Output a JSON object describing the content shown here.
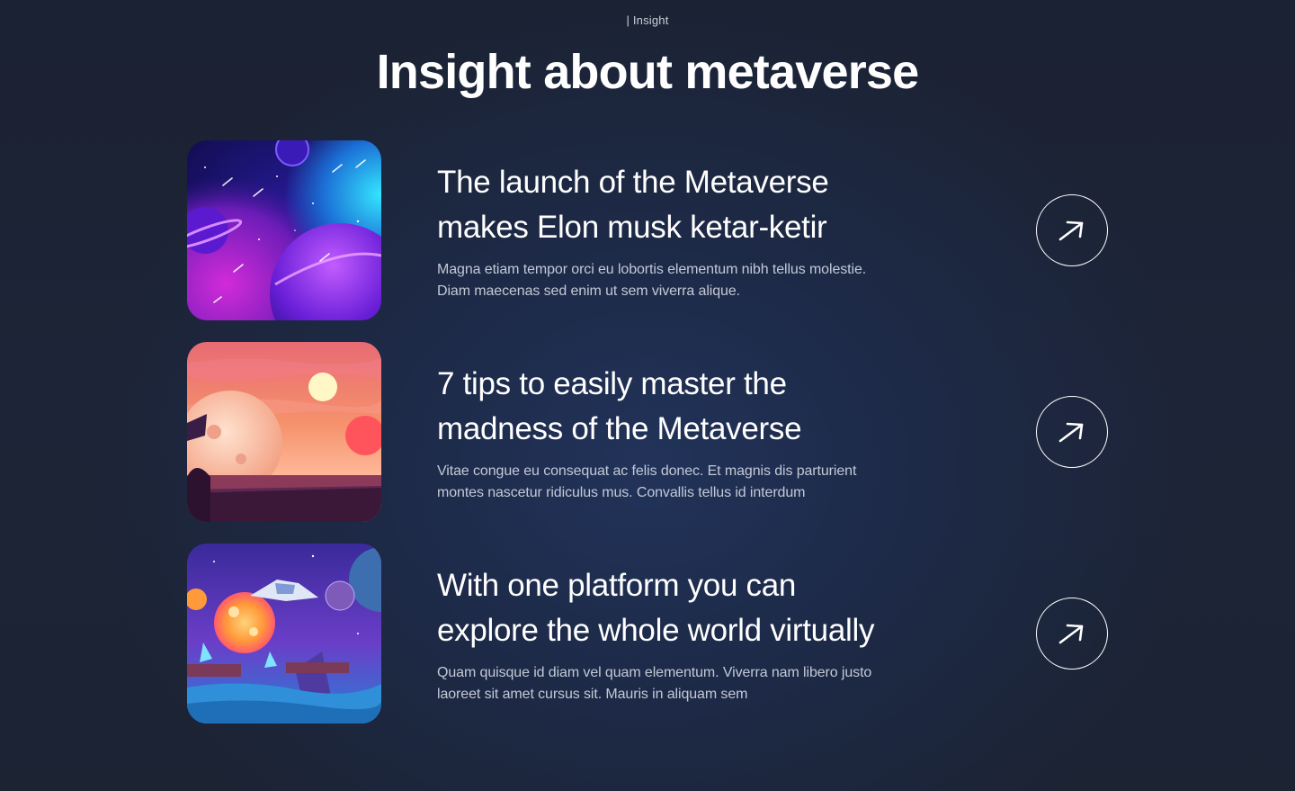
{
  "section": {
    "eyebrow": "| Insight",
    "title": "Insight about metaverse"
  },
  "articles": [
    {
      "title_line1": "The launch of the Metaverse",
      "title_line2": "makes Elon musk ketar-ketir",
      "desc_line1": "Magna etiam tempor orci eu lobortis elementum nibh tellus molestie.",
      "desc_line2": "Diam maecenas sed enim ut sem viverra alique.",
      "image_icon": "space-planets-illustration",
      "action_icon": "arrow-up-right-icon"
    },
    {
      "title_line1": "7 tips to easily master the",
      "title_line2": "madness of the Metaverse",
      "desc_line1": "Vitae congue eu consequat ac felis donec. Et magnis dis parturient",
      "desc_line2": "montes nascetur ridiculus mus. Convallis tellus id interdum",
      "image_icon": "sunset-moon-illustration",
      "action_icon": "arrow-up-right-icon"
    },
    {
      "title_line1": "With one platform you can",
      "title_line2": "explore the whole world virtually",
      "desc_line1": "Quam quisque id diam vel quam elementum. Viverra nam libero justo",
      "desc_line2": "laoreet sit amet cursus sit. Mauris in aliquam sem",
      "image_icon": "spaceship-planet-illustration",
      "action_icon": "arrow-up-right-icon"
    }
  ],
  "colors": {
    "background": "#1c2333",
    "text": "#ffffff",
    "muted_text": "#c3c9d6"
  }
}
